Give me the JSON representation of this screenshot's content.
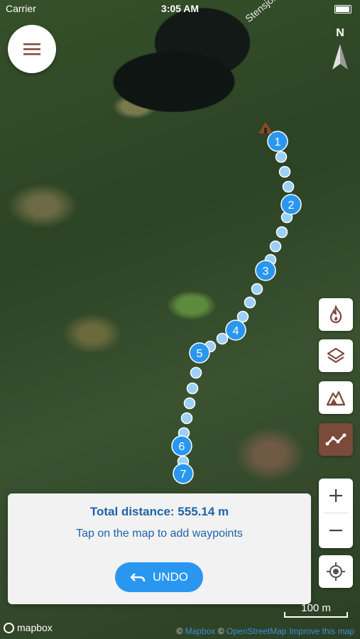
{
  "status_bar": {
    "carrier": "Carrier",
    "time": "3:05 AM"
  },
  "map": {
    "place_label": "Stensjön"
  },
  "compass": {
    "label": "N",
    "icon": "north-arrow-icon"
  },
  "menu": {
    "icon": "hamburger-menu-icon"
  },
  "route": {
    "waypoints": [
      "1",
      "2",
      "3",
      "4",
      "5",
      "6",
      "7"
    ],
    "color": "#2997f0"
  },
  "tools": [
    {
      "icon": "fire-icon",
      "active": false
    },
    {
      "icon": "layers-icon",
      "active": false
    },
    {
      "icon": "terrain-icon",
      "active": false
    },
    {
      "icon": "route-measure-icon",
      "active": true
    }
  ],
  "zoom": {
    "in_label": "+",
    "out_label": "−"
  },
  "locate": {
    "icon": "locate-crosshair-icon"
  },
  "panel": {
    "distance_text": "Total distance: 555.14 m",
    "hint_text": "Tap on the map to add waypoints",
    "undo_label": "UNDO"
  },
  "scale": {
    "label": "100 m"
  },
  "logo": {
    "text": "mapbox"
  },
  "attribution": {
    "prefix": "©",
    "mapbox": "Mapbox",
    "sep": "©",
    "osm": "OpenStreetMap",
    "improve": "Improve this map"
  },
  "colors": {
    "accent": "#2997f0",
    "text_blue": "#1f63a8",
    "active_tool": "#7a4a3a"
  }
}
